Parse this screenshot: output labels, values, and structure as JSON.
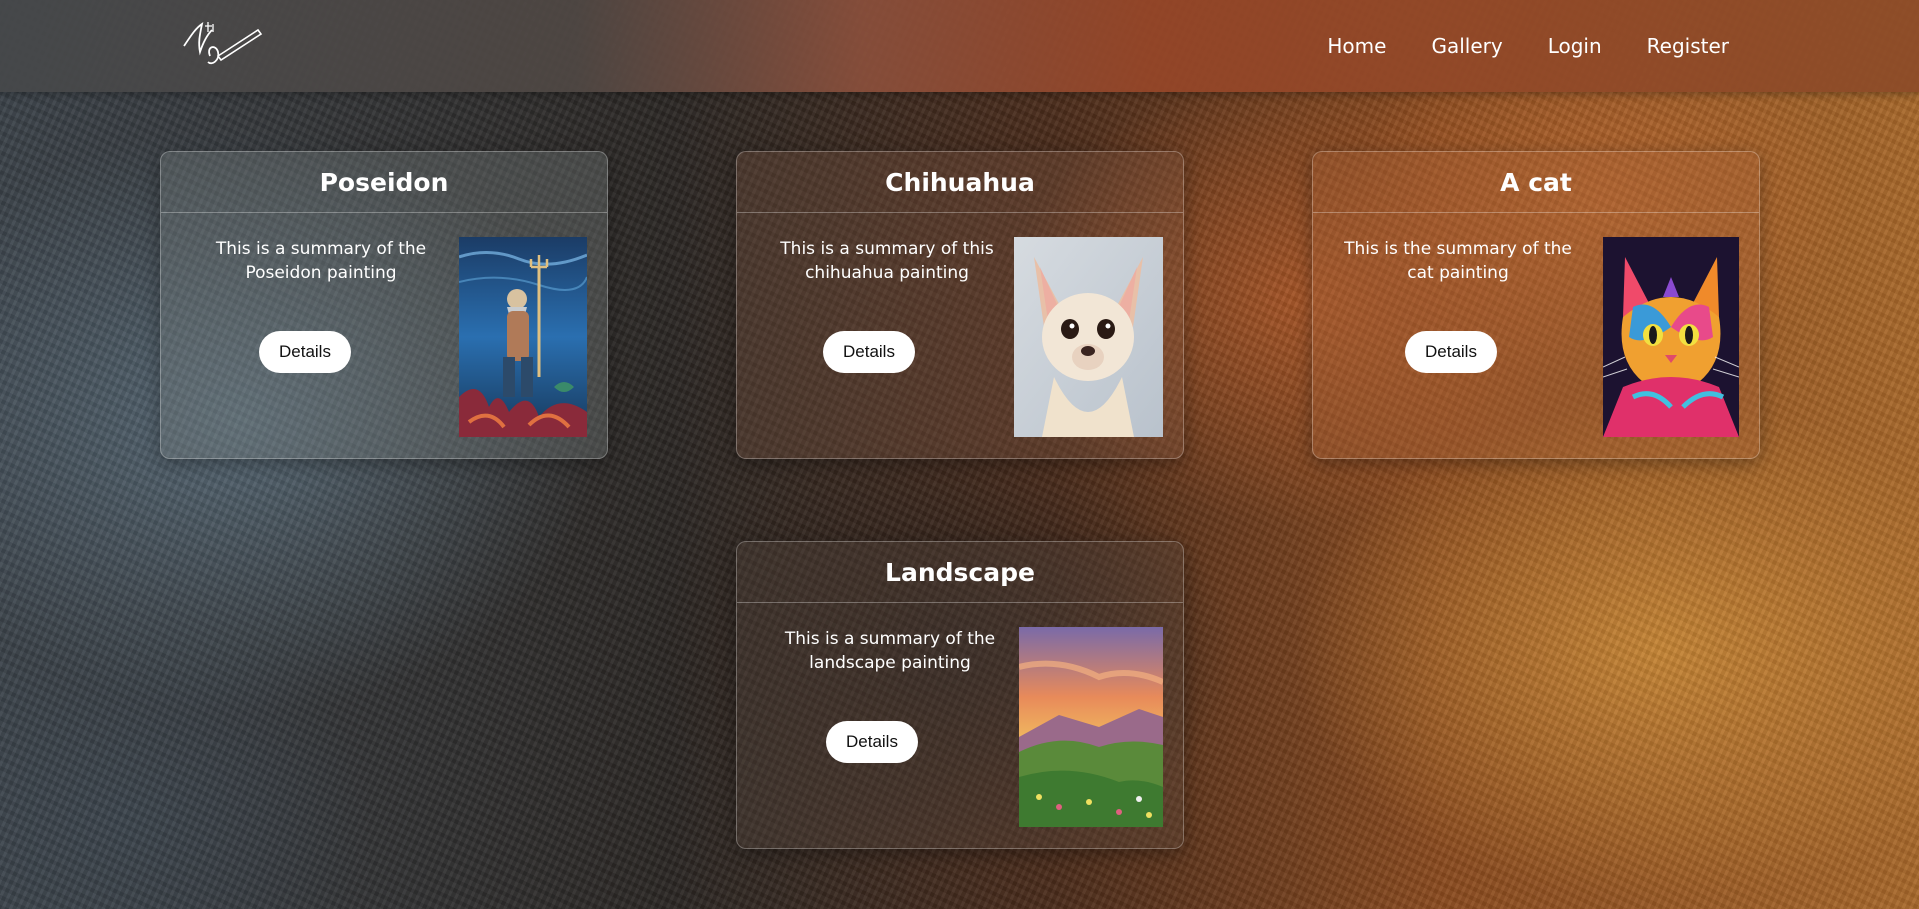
{
  "nav": {
    "logo_alt": "Art",
    "links": [
      "Home",
      "Gallery",
      "Login",
      "Register"
    ]
  },
  "cards": [
    {
      "title": "Poseidon",
      "summary": "This is a summary of the Poseidon painting",
      "button": "Details",
      "painting": "poseidon-painting"
    },
    {
      "title": "Chihuahua",
      "summary": "This is a summary of this chihuahua painting",
      "button": "Details",
      "painting": "chihuahua-painting"
    },
    {
      "title": "A cat",
      "summary": "This is the summary of the cat painting",
      "button": "Details",
      "painting": "cat-painting"
    },
    {
      "title": "Landscape",
      "summary": "This is a summary of the landscape painting",
      "button": "Details",
      "painting": "landscape-painting"
    }
  ],
  "colors": {
    "card_text": "#ffffff",
    "button_bg": "#ffffff",
    "button_text": "#111111"
  }
}
